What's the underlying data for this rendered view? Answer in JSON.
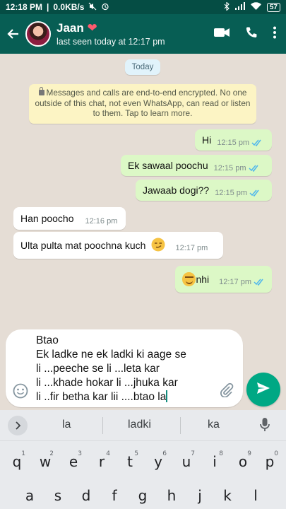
{
  "status_bar": {
    "time": "12:18 PM",
    "speed": "0.0KB/s",
    "battery": "57"
  },
  "header": {
    "contact_name": "Jaan",
    "heart": "❤",
    "last_seen": "last seen today at 12:17 pm"
  },
  "chat": {
    "date_chip": "Today",
    "encryption_notice": "Messages and calls are end-to-end encrypted. No one outside of this chat, not even WhatsApp, can read or listen to them. Tap to learn more.",
    "messages": [
      {
        "dir": "out",
        "text": "Hi",
        "time": "12:15 pm"
      },
      {
        "dir": "out",
        "text": "Ek sawaal poochu",
        "time": "12:15 pm"
      },
      {
        "dir": "out",
        "text": "Jawaab dogi??",
        "time": "12:15 pm"
      },
      {
        "dir": "in",
        "text": "Han poocho",
        "time": "12:16 pm"
      },
      {
        "dir": "in",
        "text": "Ulta pulta mat poochna kuch",
        "time": "12:17 pm"
      },
      {
        "dir": "out",
        "text": "nhi",
        "time": "12:17 pm"
      }
    ]
  },
  "composer": {
    "text": "Btao\nEk ladke ne ek ladki ki aage se\nli ...peeche se li ...leta kar\nli ...khade hokar li ...jhuka kar\nli ..fir betha kar lii ....btao la"
  },
  "keyboard": {
    "suggestions": [
      "la",
      "ladki",
      "ka"
    ],
    "row1": [
      {
        "k": "q",
        "h": "1"
      },
      {
        "k": "w",
        "h": "2"
      },
      {
        "k": "e",
        "h": "3"
      },
      {
        "k": "r",
        "h": "4"
      },
      {
        "k": "t",
        "h": "5"
      },
      {
        "k": "y",
        "h": "6"
      },
      {
        "k": "u",
        "h": "7"
      },
      {
        "k": "i",
        "h": "8"
      },
      {
        "k": "o",
        "h": "9"
      },
      {
        "k": "p",
        "h": "0"
      }
    ],
    "row2": [
      "a",
      "s",
      "d",
      "f",
      "g",
      "h",
      "j",
      "k",
      "l"
    ]
  },
  "colors": {
    "header": "#075e54",
    "outgoing": "#dcf8c6",
    "incoming": "#ffffff",
    "ticks": "#4fb6ec",
    "send": "#00a884"
  }
}
